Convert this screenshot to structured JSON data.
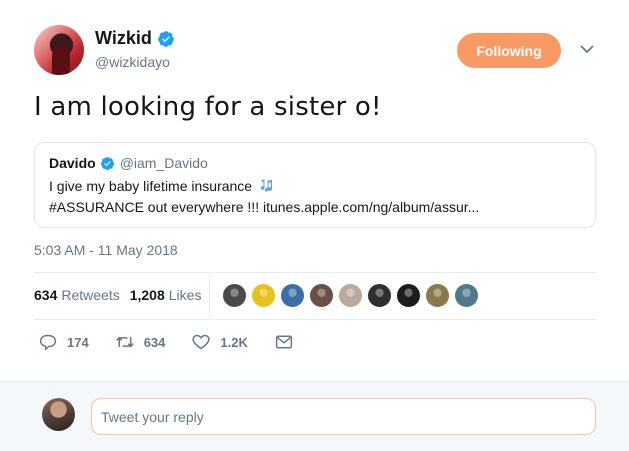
{
  "author": {
    "display_name": "Wizkid",
    "handle": "@wizkidayo",
    "verified_icon": "verified-badge-icon"
  },
  "follow_button": {
    "label": "Following",
    "color": "#f99a65"
  },
  "tweet_text": "I am looking for a sister o!",
  "quoted_tweet": {
    "display_name": "Davido",
    "handle": "@iam_Davido",
    "line1": "I give my baby lifetime insurance",
    "line1_icon": "musical-notes-icon",
    "line2": "#ASSURANCE out everywhere !!! itunes.apple.com/ng/album/assur..."
  },
  "timestamp": "5:03 AM - 11 May 2018",
  "stats": {
    "retweets_count": "634",
    "retweets_label": "Retweets",
    "likes_count": "1,208",
    "likes_label": "Likes"
  },
  "likers": [
    {
      "name": "liker-avatar-1",
      "color": "#4a4a4a"
    },
    {
      "name": "liker-avatar-2",
      "color": "#e8c11a"
    },
    {
      "name": "liker-avatar-3",
      "color": "#3a6ea5"
    },
    {
      "name": "liker-avatar-4",
      "color": "#6b4e45"
    },
    {
      "name": "liker-avatar-5",
      "color": "#b8a99a"
    },
    {
      "name": "liker-avatar-6",
      "color": "#2f2f2f"
    },
    {
      "name": "liker-avatar-7",
      "color": "#1c1c1c"
    },
    {
      "name": "liker-avatar-8",
      "color": "#8a7a4a"
    },
    {
      "name": "liker-avatar-9",
      "color": "#4f7a8a"
    }
  ],
  "actions": {
    "reply_count": "174",
    "retweet_count": "634",
    "like_count": "1.2K"
  },
  "reply": {
    "placeholder": "Tweet your reply"
  },
  "colors": {
    "accent": "#1da1f2",
    "muted_text": "#657786",
    "follow_orange": "#f99a65"
  }
}
